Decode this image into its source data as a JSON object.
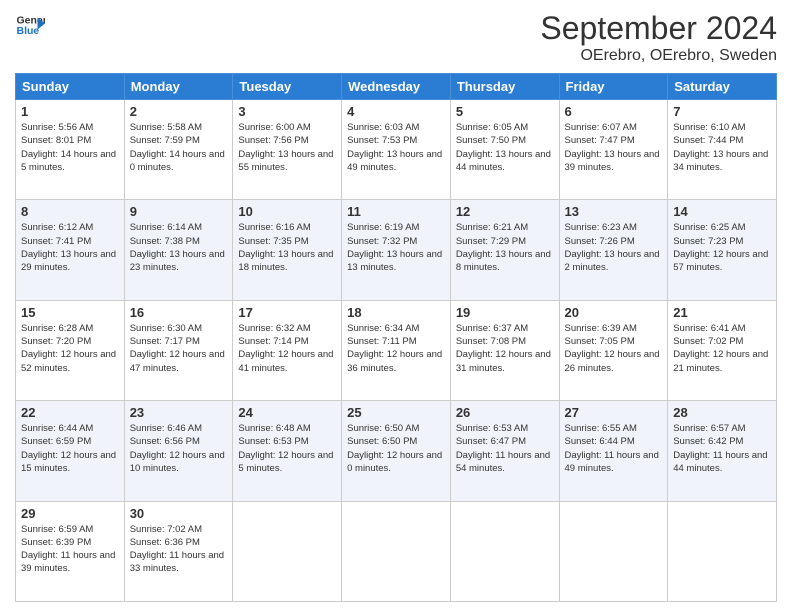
{
  "header": {
    "logo_line1": "General",
    "logo_line2": "Blue",
    "month_title": "September 2024",
    "location": "OErebro, OErebro, Sweden"
  },
  "days_of_week": [
    "Sunday",
    "Monday",
    "Tuesday",
    "Wednesday",
    "Thursday",
    "Friday",
    "Saturday"
  ],
  "weeks": [
    [
      {
        "day": "1",
        "sunrise": "5:56 AM",
        "sunset": "8:01 PM",
        "daylight": "14 hours and 5 minutes."
      },
      {
        "day": "2",
        "sunrise": "5:58 AM",
        "sunset": "7:59 PM",
        "daylight": "14 hours and 0 minutes."
      },
      {
        "day": "3",
        "sunrise": "6:00 AM",
        "sunset": "7:56 PM",
        "daylight": "13 hours and 55 minutes."
      },
      {
        "day": "4",
        "sunrise": "6:03 AM",
        "sunset": "7:53 PM",
        "daylight": "13 hours and 49 minutes."
      },
      {
        "day": "5",
        "sunrise": "6:05 AM",
        "sunset": "7:50 PM",
        "daylight": "13 hours and 44 minutes."
      },
      {
        "day": "6",
        "sunrise": "6:07 AM",
        "sunset": "7:47 PM",
        "daylight": "13 hours and 39 minutes."
      },
      {
        "day": "7",
        "sunrise": "6:10 AM",
        "sunset": "7:44 PM",
        "daylight": "13 hours and 34 minutes."
      }
    ],
    [
      {
        "day": "8",
        "sunrise": "6:12 AM",
        "sunset": "7:41 PM",
        "daylight": "13 hours and 29 minutes."
      },
      {
        "day": "9",
        "sunrise": "6:14 AM",
        "sunset": "7:38 PM",
        "daylight": "13 hours and 23 minutes."
      },
      {
        "day": "10",
        "sunrise": "6:16 AM",
        "sunset": "7:35 PM",
        "daylight": "13 hours and 18 minutes."
      },
      {
        "day": "11",
        "sunrise": "6:19 AM",
        "sunset": "7:32 PM",
        "daylight": "13 hours and 13 minutes."
      },
      {
        "day": "12",
        "sunrise": "6:21 AM",
        "sunset": "7:29 PM",
        "daylight": "13 hours and 8 minutes."
      },
      {
        "day": "13",
        "sunrise": "6:23 AM",
        "sunset": "7:26 PM",
        "daylight": "13 hours and 2 minutes."
      },
      {
        "day": "14",
        "sunrise": "6:25 AM",
        "sunset": "7:23 PM",
        "daylight": "12 hours and 57 minutes."
      }
    ],
    [
      {
        "day": "15",
        "sunrise": "6:28 AM",
        "sunset": "7:20 PM",
        "daylight": "12 hours and 52 minutes."
      },
      {
        "day": "16",
        "sunrise": "6:30 AM",
        "sunset": "7:17 PM",
        "daylight": "12 hours and 47 minutes."
      },
      {
        "day": "17",
        "sunrise": "6:32 AM",
        "sunset": "7:14 PM",
        "daylight": "12 hours and 41 minutes."
      },
      {
        "day": "18",
        "sunrise": "6:34 AM",
        "sunset": "7:11 PM",
        "daylight": "12 hours and 36 minutes."
      },
      {
        "day": "19",
        "sunrise": "6:37 AM",
        "sunset": "7:08 PM",
        "daylight": "12 hours and 31 minutes."
      },
      {
        "day": "20",
        "sunrise": "6:39 AM",
        "sunset": "7:05 PM",
        "daylight": "12 hours and 26 minutes."
      },
      {
        "day": "21",
        "sunrise": "6:41 AM",
        "sunset": "7:02 PM",
        "daylight": "12 hours and 21 minutes."
      }
    ],
    [
      {
        "day": "22",
        "sunrise": "6:44 AM",
        "sunset": "6:59 PM",
        "daylight": "12 hours and 15 minutes."
      },
      {
        "day": "23",
        "sunrise": "6:46 AM",
        "sunset": "6:56 PM",
        "daylight": "12 hours and 10 minutes."
      },
      {
        "day": "24",
        "sunrise": "6:48 AM",
        "sunset": "6:53 PM",
        "daylight": "12 hours and 5 minutes."
      },
      {
        "day": "25",
        "sunrise": "6:50 AM",
        "sunset": "6:50 PM",
        "daylight": "12 hours and 0 minutes."
      },
      {
        "day": "26",
        "sunrise": "6:53 AM",
        "sunset": "6:47 PM",
        "daylight": "11 hours and 54 minutes."
      },
      {
        "day": "27",
        "sunrise": "6:55 AM",
        "sunset": "6:44 PM",
        "daylight": "11 hours and 49 minutes."
      },
      {
        "day": "28",
        "sunrise": "6:57 AM",
        "sunset": "6:42 PM",
        "daylight": "11 hours and 44 minutes."
      }
    ],
    [
      {
        "day": "29",
        "sunrise": "6:59 AM",
        "sunset": "6:39 PM",
        "daylight": "11 hours and 39 minutes."
      },
      {
        "day": "30",
        "sunrise": "7:02 AM",
        "sunset": "6:36 PM",
        "daylight": "11 hours and 33 minutes."
      },
      null,
      null,
      null,
      null,
      null
    ]
  ]
}
